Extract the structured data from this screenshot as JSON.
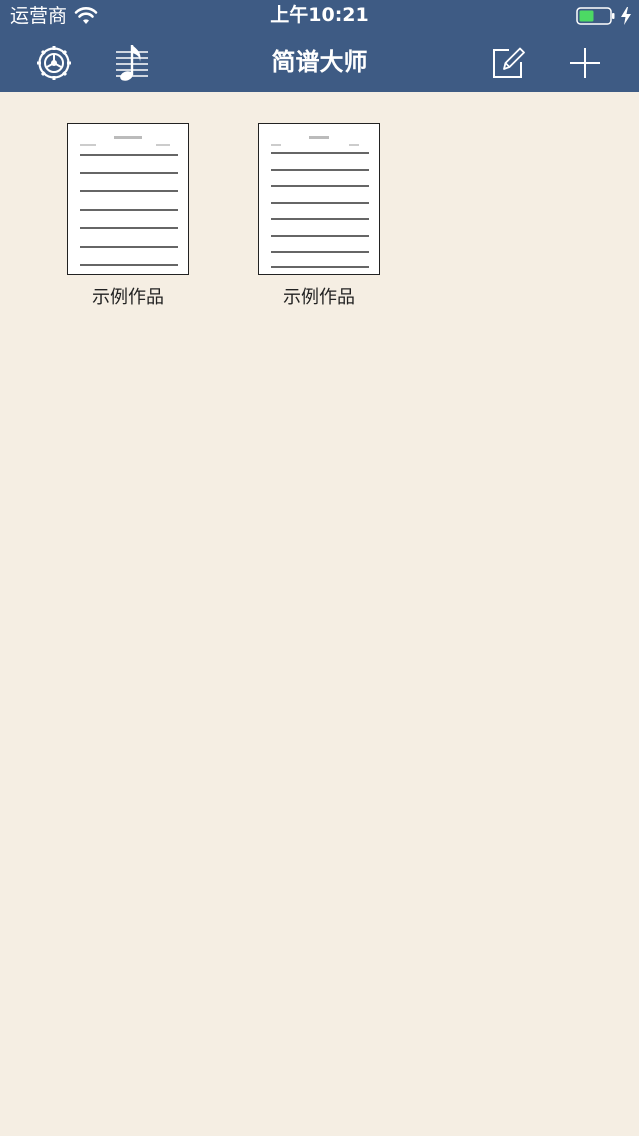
{
  "status_bar": {
    "carrier": "运营商",
    "time": "上午10:21",
    "battery_color": "#4cd964"
  },
  "navbar": {
    "title": "简谱大师",
    "buttons": [
      {
        "name": "settings",
        "icon": "gear-icon"
      },
      {
        "name": "music",
        "icon": "music-note-staff-icon"
      },
      {
        "name": "edit",
        "icon": "edit-icon"
      },
      {
        "name": "add",
        "icon": "plus-icon"
      }
    ]
  },
  "documents": [
    {
      "label": "示例作品"
    },
    {
      "label": "示例作品"
    }
  ],
  "colors": {
    "navbar_bg": "#3e5b84",
    "page_bg": "#f5eee3"
  }
}
